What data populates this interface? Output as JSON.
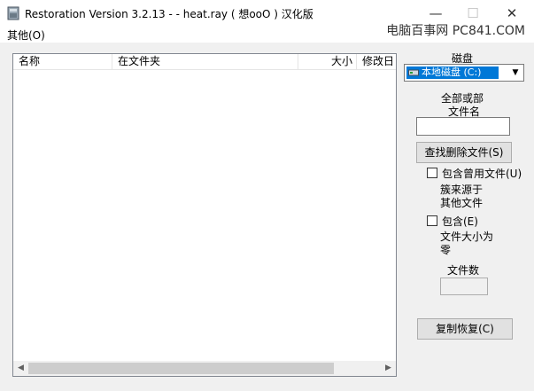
{
  "window": {
    "title": "Restoration Version 3.2.13   -  - heat.ray ( 想ooO ) 汉化版",
    "controls": {
      "minimize": "—",
      "maximize": "☐",
      "close": "✕"
    }
  },
  "menu": {
    "items": [
      {
        "label": "其他(O)"
      }
    ]
  },
  "watermark": "电脑百事网 PC841.COM",
  "list": {
    "columns": [
      "名称",
      "在文件夹",
      "大小",
      "修改日"
    ]
  },
  "side": {
    "drive_label": "磁盘",
    "drive_selected": "本地磁盘 (C:)",
    "filename_label_1": "全部或部",
    "filename_label_2": "文件名",
    "filename_value": "",
    "search_button": "查找删除文件(S)",
    "include_used_label": "包含曾用文件(U)",
    "include_used_sub_1": "簇来源于",
    "include_used_sub_2": "其他文件",
    "include_zero_label": "包含(E)",
    "include_zero_sub_1": "文件大小为",
    "include_zero_sub_2": "零",
    "file_count_label": "文件数",
    "file_count_value": "",
    "restore_button": "复制恢复(C)"
  },
  "icons": {
    "app": "restoration-app-icon",
    "drive": "hard-drive-icon",
    "dropdown": "chevron-down-icon"
  }
}
